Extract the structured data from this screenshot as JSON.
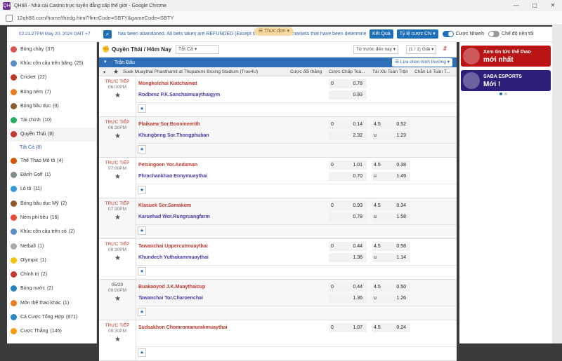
{
  "window": {
    "title": "QH88 - Nhà cái Casino trực tuyến đẳng cấp thế giới - Google Chrome",
    "url": "12qh88.com/home/thirdg.html?firmCode=SBTY&gameCode=SBTY",
    "app_icon": "QH"
  },
  "topbar": {
    "clock": "02:21:27PM May 20, 2024 GMT +7",
    "ticker": "has been abandoned. All bets taken are REFUNDED (Except those Whole Cup markets that have been determined the",
    "menu_label": "Thực đơn",
    "results_label": "Kết Quả",
    "odds_label": "Tỷ lệ cược CN",
    "quick_bet_label": "Cược Nhanh",
    "night_mode_label": "Chế độ nền tối"
  },
  "sidebar": {
    "items": [
      {
        "label": "Bóng chày",
        "count": "(37)",
        "color": "#d9534f"
      },
      {
        "label": "Khúc côn cầu trên băng",
        "count": "(25)",
        "color": "#5a8ec8"
      },
      {
        "label": "Cricket",
        "count": "(22)",
        "color": "#c0392b"
      },
      {
        "label": "Bóng ném",
        "count": "(7)",
        "color": "#e67e22"
      },
      {
        "label": "Bóng bầu dục",
        "count": "(3)",
        "color": "#8e5a2b"
      },
      {
        "label": "Tài chính",
        "count": "(10)",
        "color": "#27ae60"
      },
      {
        "label": "Quyền Thái",
        "count": "(8)",
        "color": "#c0392b"
      },
      {
        "label": "Thể Thao Mô tô",
        "count": "(4)",
        "color": "#d35400"
      },
      {
        "label": "Đánh Golf",
        "count": "(1)",
        "color": "#7f8c8d"
      },
      {
        "label": "Lô tô",
        "count": "(11)",
        "color": "#3498db"
      },
      {
        "label": "Bóng bầu dục Mỹ",
        "count": "(2)",
        "color": "#8e5a2b"
      },
      {
        "label": "Ném phi tiêu",
        "count": "(16)",
        "color": "#e74c3c"
      },
      {
        "label": "Khúc côn cầu trên cỏ",
        "count": "(2)",
        "color": "#5a8ec8"
      },
      {
        "label": "Netball",
        "count": "(1)",
        "color": "#aaaaaa"
      },
      {
        "label": "Olympic",
        "count": "(1)",
        "color": "#f1c40f"
      },
      {
        "label": "Chính trị",
        "count": "(2)",
        "color": "#c0392b"
      },
      {
        "label": "Bóng nước",
        "count": "(2)",
        "color": "#2980b9"
      },
      {
        "label": "Môn thể thao khác",
        "count": "(1)",
        "color": "#e67e22"
      },
      {
        "label": "Cá Cược Tổng Hợp",
        "count": "(671)",
        "color": "#2e86c1"
      },
      {
        "label": "Cược Thắng",
        "count": "(145)",
        "color": "#f39c12"
      }
    ],
    "sub_item": "Tất Cả (8)"
  },
  "main": {
    "section_title": "Quyền Thái / Hôm Nay",
    "filter_value": "Tất Cả",
    "sort_value": "Từ trước đến nay",
    "page_value": "(1 / 1) Giải",
    "bar_label": "Trận Đấu",
    "choose_odds_label": "Lựa chọn bình thường",
    "league": "Suek Muaythai Phanthamit at Thupatemi Boxing Stadium (True4U)",
    "col_win": "Cược đối thắng",
    "col_handicap": "Cược Chấp Toà...",
    "col_ou": "Tài Xỉu Toàn Trận",
    "col_oe": "Chẵn Lẻ Toàn T..."
  },
  "matches": [
    {
      "status": "TRỰC TIẾP",
      "time": "06:00PM",
      "home": "Mongkolchai Kiatchaiwat",
      "away": "Rodbenz P.K.Sanchaimuaythaigym",
      "hcp": "0",
      "hcp_home": "0.78",
      "hcp_away": "0.93",
      "ou_line": "",
      "ou_over": "",
      "ou_under": "",
      "ou_u_label": ""
    },
    {
      "status": "TRỰC TIẾP",
      "time": "06:30PM",
      "home": "Plaikaew Sor.Boonmeerith",
      "away": "Khungbeng Sor.Thongphuban",
      "hcp": "0",
      "hcp_home": "0.14",
      "hcp_away": "2.32",
      "ou_line": "4.5",
      "ou_over": "0.52",
      "ou_under": "1.23",
      "ou_u_label": "u"
    },
    {
      "status": "TRỰC TIẾP",
      "time": "07:00PM",
      "home": "Petsingoen Yor.Andaman",
      "away": "Phrachankhao Ennymuaythai",
      "hcp": "0",
      "hcp_home": "1.01",
      "hcp_away": "0.70",
      "ou_line": "4.5",
      "ou_over": "0.38",
      "ou_under": "1.49",
      "ou_u_label": "u"
    },
    {
      "status": "TRỰC TIẾP",
      "time": "07:30PM",
      "home": "Klasuek Sor.Samakom",
      "away": "Karuehad Wor.Rungruangfarm",
      "hcp": "0",
      "hcp_home": "0.93",
      "hcp_away": "0.78",
      "ou_line": "4.5",
      "ou_over": "0.34",
      "ou_under": "1.58",
      "ou_u_label": "u"
    },
    {
      "status": "TRỰC TIẾP",
      "time": "08:30PM",
      "home": "Tawanchai Uppercutmuaythai",
      "away": "Khundech Yuthakammuaythai",
      "hcp": "0",
      "hcp_home": "0.44",
      "hcp_away": "1.36",
      "ou_line": "4.5",
      "ou_over": "0.58",
      "ou_under": "1.14",
      "ou_u_label": "u"
    },
    {
      "status": "05/20",
      "time": "09:00PM",
      "home": "Buakaoyod J.K.Muaythaicup",
      "away": "Tawanchai Tor.Charoenchai",
      "hcp": "0",
      "hcp_home": "0.44",
      "hcp_away": "1.36",
      "ou_line": "4.5",
      "ou_over": "0.50",
      "ou_under": "1.26",
      "ou_u_label": "u"
    },
    {
      "status": "TRỰC TIẾP",
      "time": "09:30PM",
      "home": "Sudsakhon Chomromanurakmuaythai",
      "away": "",
      "hcp": "0",
      "hcp_home": "1.07",
      "hcp_away": "",
      "ou_line": "4.5",
      "ou_over": "0.24",
      "ou_under": "",
      "ou_u_label": ""
    }
  ],
  "right": {
    "banner1_top": "Xem tin tức thể thao",
    "banner1_main": "mới nhất",
    "banner2_top": "SABA ESPORTS",
    "banner2_main": "Mới !"
  },
  "colors": {
    "accent": "#1e6fb8",
    "live": "#c0392b",
    "away_team": "#4a3aa8"
  }
}
